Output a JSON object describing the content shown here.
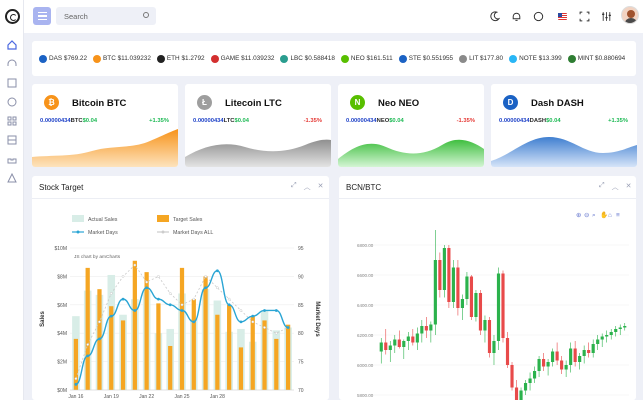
{
  "header": {
    "search_placeholder": "Search"
  },
  "ticker": [
    {
      "text": "DAS $769.22",
      "icon": "das-coin-icon",
      "color": "#1b62c4"
    },
    {
      "text": "BTC $11.039232",
      "icon": "btc-coin-icon",
      "color": "#f7931a"
    },
    {
      "text": "ETH $1.2792",
      "icon": "eth-coin-icon",
      "color": "#222222"
    },
    {
      "text": "GAME $11.039232",
      "icon": "game-coin-icon",
      "color": "#d32f2f"
    },
    {
      "text": "LBC $0.588418",
      "icon": "lbc-coin-icon",
      "color": "#2a9d8f"
    },
    {
      "text": "NEO $161.511",
      "icon": "neo-coin-icon",
      "color": "#58bf00"
    },
    {
      "text": "STE $0.551955",
      "icon": "ste-coin-icon",
      "color": "#1b62c4"
    },
    {
      "text": "LIT $177.80",
      "icon": "lit-coin-icon",
      "color": "#8a8a8a"
    },
    {
      "text": "NOTE $13.399",
      "icon": "note-coin-icon",
      "color": "#29b6f6"
    },
    {
      "text": "MINT $0.880694",
      "icon": "mint-coin-icon",
      "color": "#2e7d32"
    }
  ],
  "cards": [
    {
      "name": "Bitcoin BTC",
      "symbol": "BTC",
      "value": "0.00000434",
      "price": "$0.04",
      "change": "+1.35%",
      "change_color": "#1db954",
      "icon_glyph": "₿",
      "icon_color": "#f7931a",
      "wave_top": "#f7931a",
      "wave_bottom": "#fde3bd"
    },
    {
      "name": "Litecoin LTC",
      "symbol": "LTC",
      "value": "0.00000434",
      "price": "$0.04",
      "change": "-1.35%",
      "change_color": "#e53935",
      "icon_glyph": "Ł",
      "icon_color": "#9e9e9e",
      "wave_top": "#8f8f8f",
      "wave_bottom": "#e4e4e4"
    },
    {
      "name": "Neo NEO",
      "symbol": "NEO",
      "value": "0.00000434",
      "price": "$0.04",
      "change": "-1.35%",
      "change_color": "#e53935",
      "icon_glyph": "N",
      "icon_color": "#58bf00",
      "wave_top": "#3fbf3f",
      "wave_bottom": "#d4f5d4"
    },
    {
      "name": "Dash DASH",
      "symbol": "DASH",
      "value": "0.00000434",
      "price": "$0.04",
      "change": "+1.35%",
      "change_color": "#1db954",
      "icon_glyph": "D",
      "icon_color": "#1b62c4",
      "wave_top": "#3f7fd0",
      "wave_bottom": "#d5e4f8"
    }
  ],
  "stock_panel": {
    "title": "Stock Target"
  },
  "bcn_panel": {
    "title": "BCN/BTC"
  },
  "chart_data": [
    {
      "type": "bar",
      "title": "",
      "legend": [
        "Actual Sales",
        "Target Sales",
        "Market Days",
        "Market Days ALL"
      ],
      "annotation": "JS chart by amCharts",
      "ylabel": "Sales",
      "y2label": "Market Days",
      "ylim": [
        0,
        10
      ],
      "y2lim": [
        70,
        95
      ],
      "y_ticks": [
        "$0M",
        "$2M",
        "$4M",
        "$6M",
        "$8M",
        "$10M"
      ],
      "y2_ticks": [
        "70",
        "75",
        "80",
        "85",
        "90",
        "95"
      ],
      "x_ticks": [
        "Jan 16",
        "Jan 19",
        "Jan 22",
        "Jan 25",
        "Jan 28"
      ],
      "series": [
        {
          "name": "Actual Sales",
          "values": [
            5.2,
            7.0,
            6.7,
            8.1,
            5.3,
            6.4,
            7.0,
            4.0,
            4.3,
            6.8,
            5.0,
            7.1,
            6.3,
            4.1,
            4.3,
            3.4,
            5.6,
            4.2,
            4.4
          ]
        },
        {
          "name": "Target Sales",
          "values": [
            3.6,
            8.6,
            7.1,
            5.9,
            4.9,
            9.1,
            8.3,
            6.1,
            3.1,
            8.6,
            6.4,
            8.0,
            5.3,
            6.0,
            3.0,
            5.2,
            4.9,
            3.6,
            4.6
          ]
        },
        {
          "name": "Market Days",
          "values": [
            71,
            76,
            79,
            83,
            86,
            84,
            88,
            86,
            85,
            84,
            82,
            88,
            91,
            85,
            82,
            83,
            84,
            84,
            81
          ]
        },
        {
          "name": "Market Days ALL",
          "values": [
            72,
            78,
            82,
            87,
            90,
            92,
            89,
            90,
            87,
            85,
            86,
            90,
            88,
            86,
            84,
            82,
            81,
            80,
            81
          ]
        }
      ]
    },
    {
      "type": "candlestick",
      "y_ticks": [
        "6800.00",
        "6600.00",
        "6400.00",
        "6200.00",
        "6000.00",
        "5800.00"
      ],
      "ylim": [
        5700,
        6900
      ],
      "candles": [
        [
          6090,
          6180,
          6010,
          6150
        ],
        [
          6150,
          6240,
          6070,
          6100
        ],
        [
          6100,
          6160,
          6020,
          6130
        ],
        [
          6130,
          6200,
          6080,
          6170
        ],
        [
          6170,
          6230,
          6110,
          6120
        ],
        [
          6120,
          6170,
          6040,
          6160
        ],
        [
          6160,
          6220,
          6100,
          6190
        ],
        [
          6190,
          6240,
          6130,
          6150
        ],
        [
          6150,
          6250,
          6100,
          6210
        ],
        [
          6210,
          6300,
          6150,
          6260
        ],
        [
          6260,
          6320,
          6180,
          6230
        ],
        [
          6230,
          6290,
          6150,
          6270
        ],
        [
          6270,
          6900,
          6200,
          6700
        ],
        [
          6700,
          6750,
          6450,
          6500
        ],
        [
          6500,
          6800,
          6450,
          6780
        ],
        [
          6780,
          6800,
          6380,
          6420
        ],
        [
          6420,
          6700,
          6380,
          6650
        ],
        [
          6650,
          6700,
          6330,
          6380
        ],
        [
          6380,
          6470,
          6300,
          6440
        ],
        [
          6440,
          6620,
          6400,
          6590
        ],
        [
          6590,
          6600,
          6300,
          6320
        ],
        [
          6320,
          6500,
          6290,
          6480
        ],
        [
          6480,
          6500,
          6200,
          6230
        ],
        [
          6230,
          6330,
          6150,
          6300
        ],
        [
          6300,
          6320,
          6050,
          6080
        ],
        [
          6080,
          6200,
          6000,
          6160
        ],
        [
          6160,
          6650,
          6100,
          6610
        ],
        [
          6610,
          6630,
          6150,
          6180
        ],
        [
          6180,
          6220,
          5980,
          6000
        ],
        [
          6000,
          6020,
          5830,
          5850
        ],
        [
          5850,
          5900,
          5720,
          5760
        ],
        [
          5760,
          5850,
          5700,
          5830
        ],
        [
          5830,
          5900,
          5800,
          5880
        ],
        [
          5880,
          5950,
          5830,
          5910
        ],
        [
          5910,
          5990,
          5880,
          5960
        ],
        [
          5960,
          6060,
          5920,
          6040
        ],
        [
          6040,
          6080,
          5960,
          5990
        ],
        [
          5990,
          6040,
          5930,
          6020
        ],
        [
          6020,
          6110,
          5990,
          6090
        ],
        [
          6090,
          6150,
          6000,
          6030
        ],
        [
          6030,
          6060,
          5940,
          5970
        ],
        [
          5970,
          6030,
          5920,
          6000
        ],
        [
          6000,
          6150,
          5950,
          6110
        ],
        [
          6110,
          6160,
          5990,
          6020
        ],
        [
          6020,
          6080,
          5970,
          6060
        ],
        [
          6060,
          6130,
          6010,
          6100
        ],
        [
          6100,
          6150,
          6050,
          6080
        ],
        [
          6080,
          6170,
          6050,
          6140
        ],
        [
          6140,
          6200,
          6100,
          6170
        ],
        [
          6170,
          6210,
          6120,
          6190
        ],
        [
          6190,
          6230,
          6150,
          6200
        ],
        [
          6200,
          6240,
          6170,
          6220
        ],
        [
          6220,
          6260,
          6190,
          6240
        ],
        [
          6240,
          6270,
          6200,
          6250
        ],
        [
          6250,
          6280,
          6230,
          6260
        ]
      ]
    }
  ]
}
